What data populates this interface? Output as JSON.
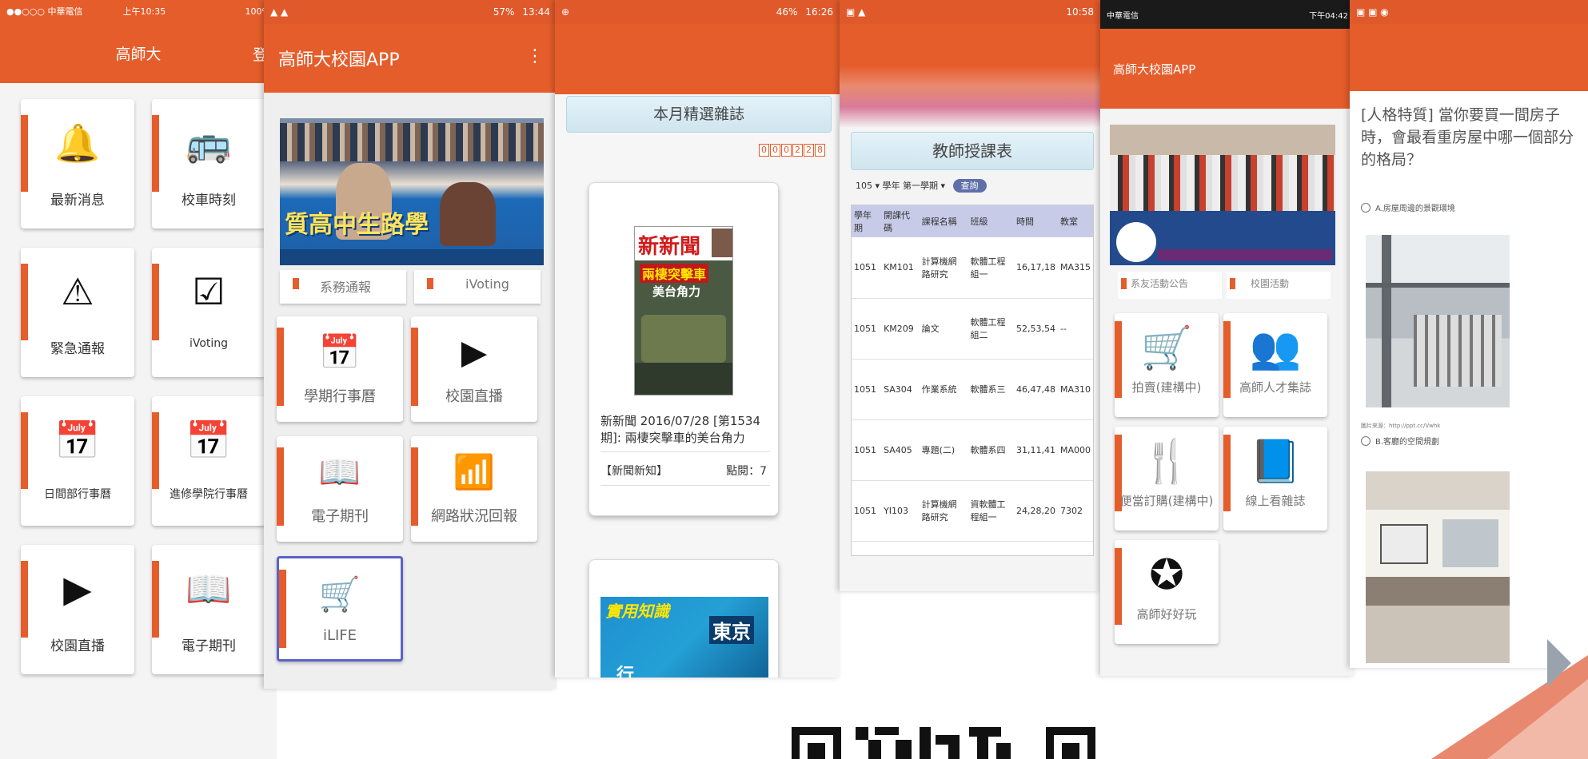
{
  "phone1": {
    "status": {
      "carrier": "●●○○○ 中華電信",
      "time": "上午10:35",
      "battery": "100%"
    },
    "title": "高師大",
    "login": "登入",
    "tiles": [
      {
        "label": "最新消息",
        "icon": "bell-icon",
        "glyph": "🔔"
      },
      {
        "label": "校車時刻",
        "icon": "bus-icon",
        "glyph": "🚌"
      },
      {
        "label": "緊急通報",
        "icon": "warning-icon",
        "glyph": "⚠"
      },
      {
        "label": "iVoting",
        "icon": "check-box-icon",
        "glyph": "☑"
      },
      {
        "label": "日間部行事曆",
        "icon": "calendar-icon",
        "glyph": "📅"
      },
      {
        "label": "進修學院行事曆",
        "icon": "calendar-icon",
        "glyph": "📅"
      },
      {
        "label": "校園直播",
        "icon": "video-library-icon",
        "glyph": "▶"
      },
      {
        "label": "電子期刊",
        "icon": "reading-book-icon",
        "glyph": "📖"
      }
    ]
  },
  "phone2": {
    "status": {
      "time": "13:44",
      "battery": "57%"
    },
    "title": "高師大校園APP",
    "menu_icon": "more-vert-icon",
    "banner_caption": "質高中生路學",
    "cut_labels": [
      "系務通報",
      "iVoting"
    ],
    "tiles": [
      {
        "label": "學期行事曆",
        "icon": "calendar-icon",
        "glyph": "📅"
      },
      {
        "label": "校園直播",
        "icon": "video-library-icon",
        "glyph": "▶"
      },
      {
        "label": "電子期刊",
        "icon": "reading-book-icon",
        "glyph": "📖"
      },
      {
        "label": "網路狀況回報",
        "icon": "wifi-signal-icon",
        "glyph": "📶"
      },
      {
        "label": "iLIFE",
        "icon": "cart-icon",
        "glyph": "🛒"
      }
    ]
  },
  "phone3": {
    "status": {
      "time": "16:26",
      "battery": "46%"
    },
    "header": "本月精選雜誌",
    "counter": "000228",
    "magazine": {
      "title": "新新聞 2016/07/28 [第1534期]: 兩棲突擊車的美台角力",
      "category": "【新聞新知】",
      "views": "點閱：7",
      "cover_masthead": "新新聞",
      "cover_headline": "兩棲突擊車",
      "cover_sub": "美台角力"
    },
    "second_cover": {
      "masthead": "實用知識",
      "text": "東京",
      "text2": "行"
    }
  },
  "phone4": {
    "status": {
      "time": "10:58"
    },
    "header": "教師授課表",
    "filter": "105 ▾ 學年 第一學期 ▾",
    "query_button": "查詢",
    "columns": [
      "學年期",
      "開課代碼",
      "課程名稱",
      "班級",
      "時間",
      "教室"
    ],
    "rows": [
      {
        "term": "1051",
        "code": "KM101",
        "name": "計算機網路研究",
        "class": "軟體工程組一",
        "time": "16,17,18",
        "room": "MA315"
      },
      {
        "term": "1051",
        "code": "KM209",
        "name": "論文",
        "class": "軟體工程組二",
        "time": "52,53,54",
        "room": "--"
      },
      {
        "term": "1051",
        "code": "SA304",
        "name": "作業系統",
        "class": "軟體系三",
        "time": "46,47,48",
        "room": "MA310"
      },
      {
        "term": "1051",
        "code": "SA405",
        "name": "專題(二)",
        "class": "軟體系四",
        "time": "31,11,41",
        "room": "MA000"
      },
      {
        "term": "1051",
        "code": "YI103",
        "name": "計算機網路研究",
        "class": "資軟體工程組一",
        "time": "24,28,20",
        "room": "7302"
      }
    ]
  },
  "phone5": {
    "status": {
      "carrier": "中華電信",
      "time": "下午04:42"
    },
    "title": "高師大校園APP",
    "cut_labels": [
      "系友活動公告",
      "校園活動"
    ],
    "tiles": [
      {
        "label": "拍賣(建構中)",
        "icon": "cart-icon",
        "glyph": "🛒"
      },
      {
        "label": "高師人才集誌",
        "icon": "people-icon",
        "glyph": "👥"
      },
      {
        "label": "便當訂購(建構中)",
        "icon": "fork-knife-icon",
        "glyph": "🍴"
      },
      {
        "label": "線上看雜誌",
        "icon": "book-icon",
        "glyph": "📘"
      },
      {
        "label": "高師好好玩",
        "icon": "star-badge-icon",
        "glyph": "✪"
      }
    ]
  },
  "phone6": {
    "article_title": "[人格特質] 當你要買一間房子時，會最看重房屋中哪一個部分的格局？",
    "option_a": "A.房屋周邊的景觀環境",
    "source": "圖片來源：http://ppt.cc/Vwhk",
    "option_b": "B.客廳的空間規劃"
  },
  "qr_label": "QR code",
  "colors": {
    "accent": "#e55d2b",
    "header_blue": "#d6eaf3",
    "table_head": "#c7cbe8",
    "selected_border": "#5a63c9"
  }
}
